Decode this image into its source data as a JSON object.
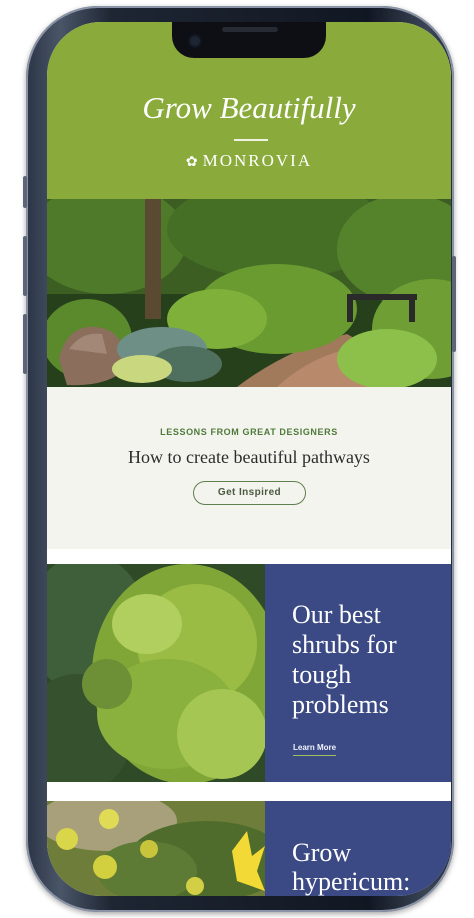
{
  "header": {
    "tagline": "Grow Beautifully",
    "brand": "MONROVIA",
    "brand_icon": "leaf-logo-icon",
    "bg_color": "#8aab3c"
  },
  "feature": {
    "eyebrow": "LESSONS FROM GREAT DESIGNERS",
    "headline": "How to create beautiful pathways",
    "cta_label": "Get Inspired"
  },
  "promos": [
    {
      "title": "Our best shrubs for tough problems",
      "link_label": "Learn More",
      "bg_color": "#3b4a84"
    },
    {
      "title": "Grow hypericum:",
      "bg_color": "#3b4a84"
    }
  ]
}
